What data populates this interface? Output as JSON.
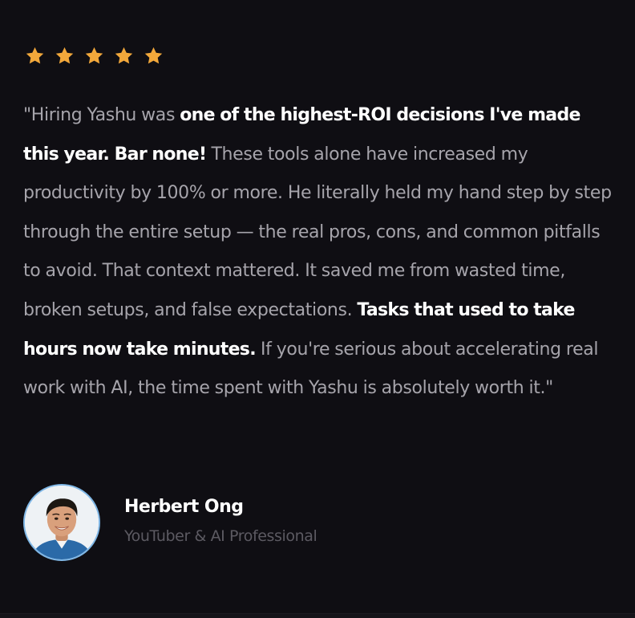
{
  "rating": {
    "stars": 5,
    "max": 5,
    "star_color": "#f2a83b",
    "icon": "star-icon"
  },
  "testimonial": {
    "segments": [
      {
        "text": "\"Hiring Yashu was ",
        "bold": false
      },
      {
        "text": "one of the highest-ROI decisions I've made this year. Bar none!",
        "bold": true
      },
      {
        "text": " These tools alone have increased my productivity by 100% or more. He literally held my hand step by step through the entire setup — the real pros, cons, and common pitfalls to avoid. That context mattered. It saved me from wasted time, broken setups, and false expectations. ",
        "bold": false
      },
      {
        "text": "Tasks that used to take hours now take minutes.",
        "bold": true
      },
      {
        "text": " If you're serious about accelerating real work with AI, the time spent with Yashu is absolutely worth it.\"",
        "bold": false
      }
    ]
  },
  "author": {
    "name": "Herbert Ong",
    "role": "YouTuber & AI Professional",
    "avatar_border_color": "#7fb7e6"
  },
  "colors": {
    "background": "#0f0e13",
    "text_muted": "#a6a4ab",
    "text_highlight": "#ffffff",
    "role_text": "#5c5a62"
  }
}
